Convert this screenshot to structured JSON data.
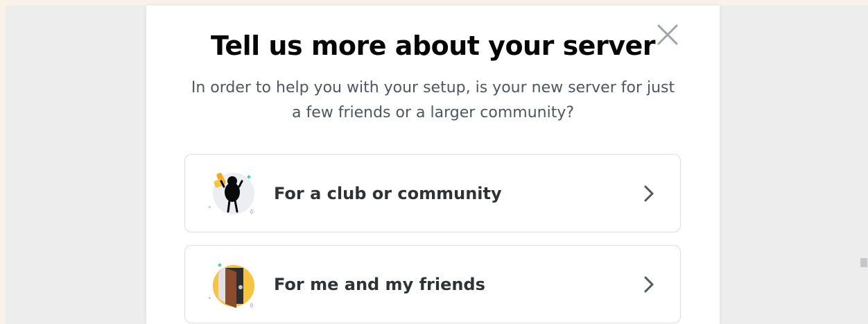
{
  "modal": {
    "title": "Tell us more about your server",
    "subtitle": "In order to help you with your setup, is your new server for just a few friends or a larger community?",
    "close_icon": "close-icon"
  },
  "options": [
    {
      "label": "For a club or community",
      "icon": "club-mascot-icon"
    },
    {
      "label": "For me and my friends",
      "icon": "door-icon"
    }
  ],
  "colors": {
    "title": "#060607",
    "subtitle": "#4f5660",
    "label": "#2e3338",
    "border": "#dcdee2",
    "accent_yellow": "#f6c343",
    "accent_orange": "#f5a623"
  }
}
